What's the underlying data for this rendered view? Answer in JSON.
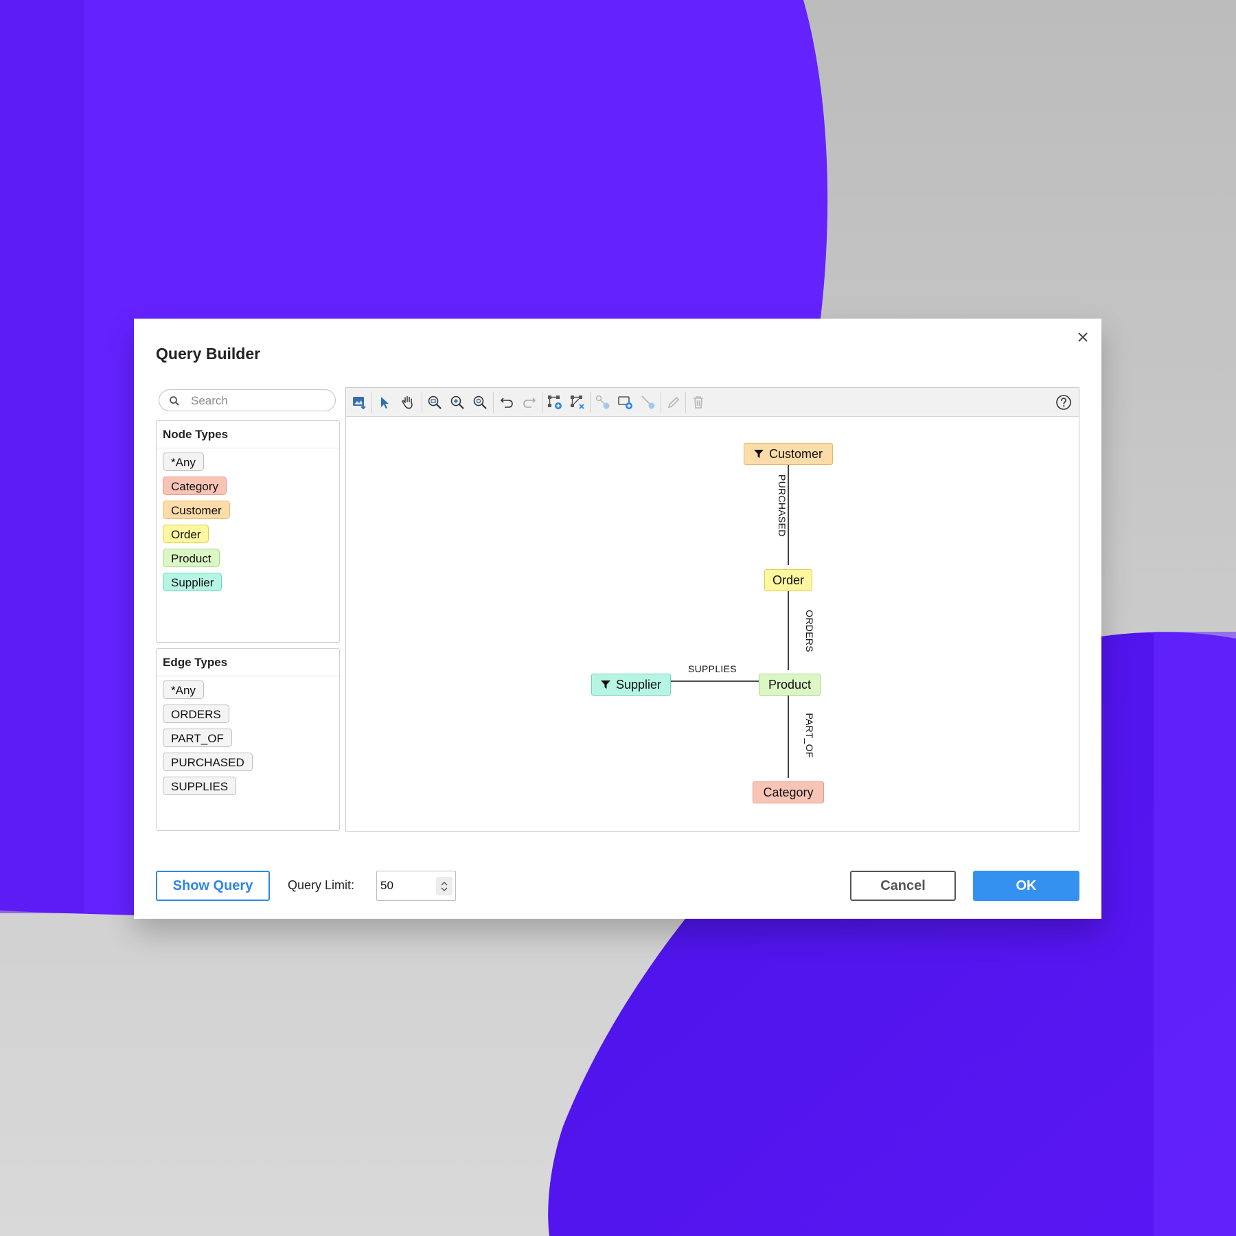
{
  "dialog": {
    "title": "Query Builder"
  },
  "search": {
    "placeholder": "Search"
  },
  "node_types": {
    "heading": "Node Types",
    "items": [
      {
        "label": "*Any",
        "color": "#f3f3f3",
        "border": "#bdbdbd"
      },
      {
        "label": "Category",
        "color": "#f7c4b6",
        "border": "#e59a86"
      },
      {
        "label": "Customer",
        "color": "#fcdca8",
        "border": "#e6b86a"
      },
      {
        "label": "Order",
        "color": "#fdf7a0",
        "border": "#dccd4c"
      },
      {
        "label": "Product",
        "color": "#dcf7c6",
        "border": "#a6d884"
      },
      {
        "label": "Supplier",
        "color": "#b6f5e4",
        "border": "#6fd3b8"
      }
    ]
  },
  "edge_types": {
    "heading": "Edge Types",
    "items": [
      {
        "label": "*Any"
      },
      {
        "label": "ORDERS"
      },
      {
        "label": "PART_OF"
      },
      {
        "label": "PURCHASED"
      },
      {
        "label": "SUPPLIES"
      }
    ]
  },
  "toolbar": {
    "icons": [
      "export-image-icon",
      "select-pointer-icon",
      "pan-hand-icon",
      "zoom-fit-icon",
      "zoom-in-icon",
      "zoom-reset-icon",
      "undo-icon",
      "redo-icon",
      "add-node-icon",
      "add-edge-icon",
      "link-node-icon",
      "new-node-icon",
      "connect-icon",
      "edit-icon",
      "delete-icon",
      "help-icon"
    ]
  },
  "graph": {
    "nodes": {
      "customer": {
        "label": "Customer",
        "filter": true
      },
      "order": {
        "label": "Order",
        "filter": false
      },
      "product": {
        "label": "Product",
        "filter": false
      },
      "supplier": {
        "label": "Supplier",
        "filter": true
      },
      "category": {
        "label": "Category",
        "filter": false
      }
    },
    "edges": {
      "purchased": "PURCHASED",
      "orders": "ORDERS",
      "supplies": "SUPPLIES",
      "part_of": "PART_OF"
    }
  },
  "footer": {
    "show_query": "Show Query",
    "limit_label": "Query Limit:",
    "limit_value": "50",
    "cancel": "Cancel",
    "ok": "OK"
  },
  "colors": {
    "accent": "#3591f0",
    "background_purple": "#6422ff",
    "background_gray": "#b3b3b3"
  }
}
